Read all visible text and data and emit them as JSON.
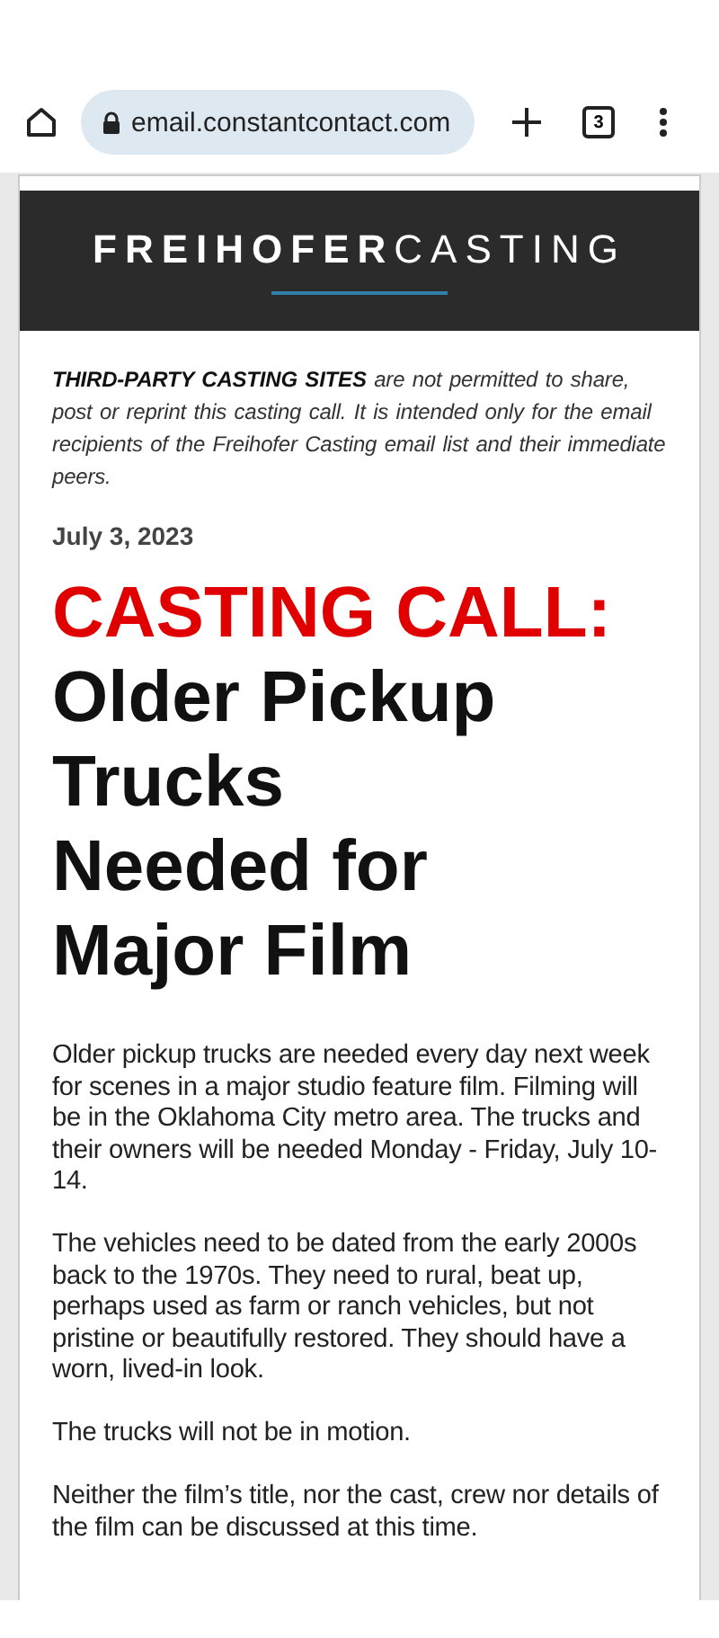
{
  "browser": {
    "url": "email.constantcontact.com",
    "tab_count": "3"
  },
  "email": {
    "logo": {
      "bold": "FREIHOFER",
      "light": "CASTING"
    },
    "notice": "**THIRD-PARTY CASTING SITES** are not permitted to share, post or reprint this casting call. It is intended only for the email recipients of the Freihofer Casting email list and their immediate peers.",
    "date": "July 3, 2023",
    "headline_lead": "CASTING CALL:",
    "headline": "Older Pickup Trucks Needed for Major Film",
    "paragraphs": [
      "Older pickup trucks are needed every day next week for scenes in a major studio feature film. Filming will be in the Oklahoma City metro area. The trucks and their owners will be needed Monday - Friday, July 10-14.",
      "The vehicles need to be dated from the early 2000s back to the 1970s. They need to rural, beat up, perhaps used as farm or ranch vehicles, but not pristine or beautifully restored. They should have a worn, lived-in look.",
      "The trucks will not be in motion.",
      "Neither the film’s title, nor the cast, crew nor details of the film can be discussed at this time."
    ]
  }
}
